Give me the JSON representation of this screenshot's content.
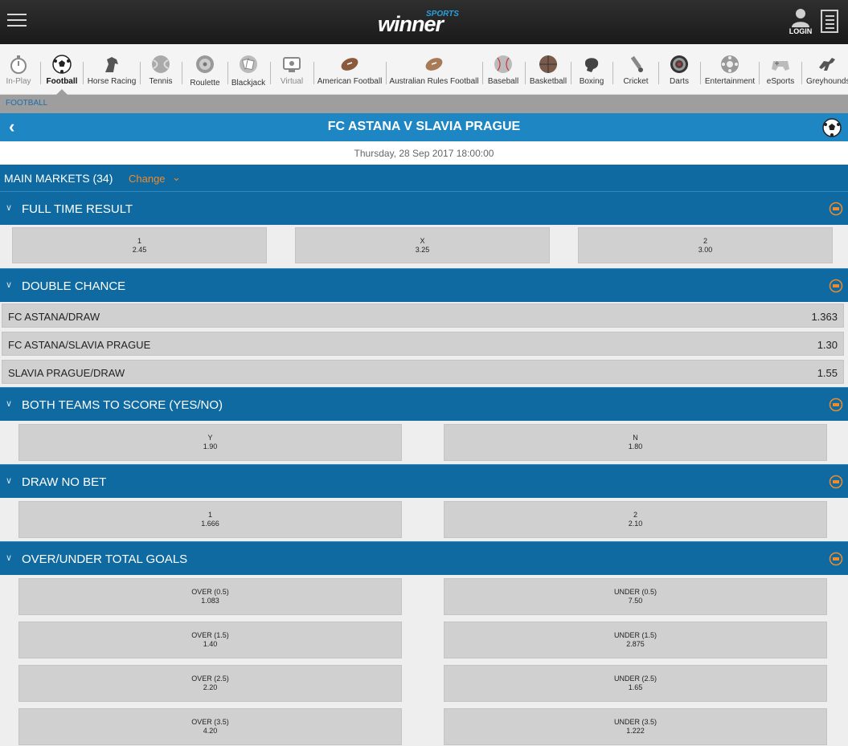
{
  "header": {
    "logo_text": "winner",
    "logo_super": "SPORTS",
    "login_label": "LOGIN"
  },
  "sports": [
    {
      "label": "In-Play",
      "icon": "stopwatch-icon"
    },
    {
      "label": "Football",
      "icon": "football-icon"
    },
    {
      "label": "Horse Racing",
      "icon": "horse-icon"
    },
    {
      "label": "Tennis",
      "icon": "tennis-ball-icon"
    },
    {
      "label": "Roulette",
      "icon": "roulette-icon"
    },
    {
      "label": "Blackjack",
      "icon": "cards-icon"
    },
    {
      "label": "Virtual",
      "icon": "virtual-icon"
    },
    {
      "label": "American Football",
      "icon": "american-football-icon"
    },
    {
      "label": "Australian Rules Football",
      "icon": "aussie-rules-icon"
    },
    {
      "label": "Baseball",
      "icon": "baseball-icon"
    },
    {
      "label": "Basketball",
      "icon": "basketball-icon"
    },
    {
      "label": "Boxing",
      "icon": "boxing-glove-icon"
    },
    {
      "label": "Cricket",
      "icon": "cricket-icon"
    },
    {
      "label": "Darts",
      "icon": "dartboard-icon"
    },
    {
      "label": "Entertainment",
      "icon": "popcorn-icon"
    },
    {
      "label": "eSports",
      "icon": "gamepad-icon"
    },
    {
      "label": "Greyhounds",
      "icon": "greyhound-icon"
    }
  ],
  "breadcrumb": "FOOTBALL",
  "event": {
    "title": "FC ASTANA V SLAVIA PRAGUE",
    "date": "Thursday, 28 Sep 2017 18:00:00"
  },
  "markets": {
    "title": "MAIN MARKETS (34)",
    "change_label": "Change",
    "change_chevron": "⌄"
  },
  "sections": {
    "full_time": {
      "title": "FULL TIME RESULT",
      "outcomes": [
        {
          "label": "1",
          "odds": "2.45"
        },
        {
          "label": "X",
          "odds": "3.25"
        },
        {
          "label": "2",
          "odds": "3.00"
        }
      ]
    },
    "double_chance": {
      "title": "DOUBLE CHANCE",
      "rows": [
        {
          "label": "FC ASTANA/DRAW",
          "odds": "1.363"
        },
        {
          "label": "FC ASTANA/SLAVIA PRAGUE",
          "odds": "1.30"
        },
        {
          "label": "SLAVIA PRAGUE/DRAW",
          "odds": "1.55"
        }
      ]
    },
    "btts": {
      "title": "BOTH TEAMS TO SCORE (YES/NO)",
      "outcomes": [
        {
          "label": "Y",
          "odds": "1.90"
        },
        {
          "label": "N",
          "odds": "1.80"
        }
      ]
    },
    "dnb": {
      "title": "DRAW NO BET",
      "outcomes": [
        {
          "label": "1",
          "odds": "1.666"
        },
        {
          "label": "2",
          "odds": "2.10"
        }
      ]
    },
    "ou": {
      "title": "OVER/UNDER TOTAL GOALS",
      "outcomes": [
        {
          "label": "OVER (0.5)",
          "odds": "1.083"
        },
        {
          "label": "UNDER (0.5)",
          "odds": "7.50"
        },
        {
          "label": "OVER (1.5)",
          "odds": "1.40"
        },
        {
          "label": "UNDER (1.5)",
          "odds": "2.875"
        },
        {
          "label": "OVER (2.5)",
          "odds": "2.20"
        },
        {
          "label": "UNDER (2.5)",
          "odds": "1.65"
        },
        {
          "label": "OVER (3.5)",
          "odds": "4.20"
        },
        {
          "label": "UNDER (3.5)",
          "odds": "1.222"
        }
      ]
    }
  },
  "colors": {
    "accent": "#0e6aa0",
    "event_bar": "#1e86c3",
    "orange": "#f08a2a"
  }
}
